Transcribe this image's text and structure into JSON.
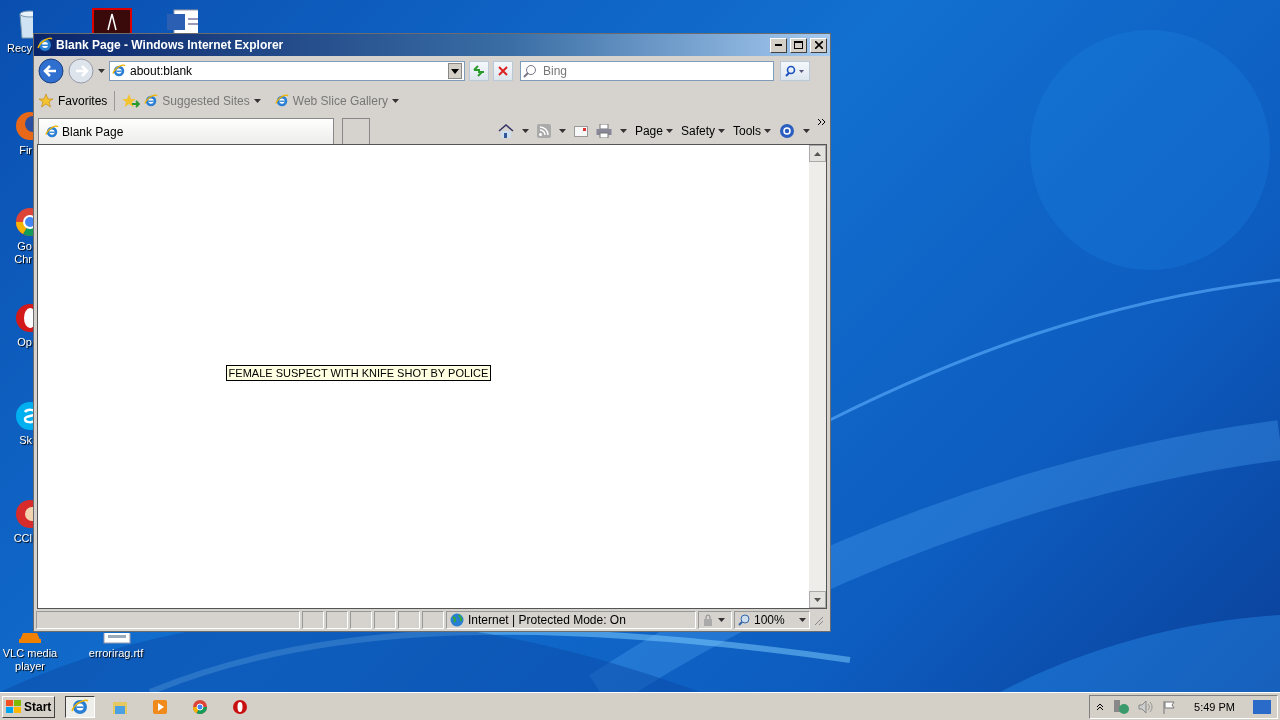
{
  "desktop": {
    "icons": [
      {
        "kind": "bin",
        "lines": [
          "Recy"
        ]
      },
      {
        "kind": "pdf"
      },
      {
        "kind": "word"
      },
      {
        "kind": "fox",
        "lines": [
          "Fir"
        ]
      },
      {
        "kind": "chrome",
        "lines": [
          "Go",
          "Chr"
        ]
      },
      {
        "kind": "opera",
        "lines": [
          "Op"
        ]
      },
      {
        "kind": "skype",
        "lines": [
          "Sk"
        ]
      },
      {
        "kind": "ccleaner",
        "lines": [
          "CCl"
        ]
      },
      {
        "kind": "vlc",
        "lines": [
          "VLC media",
          "player"
        ]
      },
      {
        "kind": "rtf",
        "lines": [
          "errorirag.rtf"
        ]
      }
    ]
  },
  "window": {
    "title": "Blank Page - Windows Internet Explorer",
    "address": "about:blank",
    "search": {
      "placeholder": "Bing"
    },
    "favorites": {
      "label": "Favorites",
      "items": [
        "Suggested Sites",
        "Web Slice Gallery"
      ]
    },
    "tabs": [
      {
        "label": "Blank Page",
        "selected": true
      }
    ],
    "commands": [
      "Page",
      "Safety",
      "Tools"
    ],
    "content": {
      "text": "FEMALE SUSPECT WITH KNIFE SHOT BY POLICE"
    },
    "status_bar": {
      "zone": "Internet | Protected Mode: On",
      "zoom": "100%"
    }
  },
  "taskbar": {
    "start": "Start",
    "pinned": [
      {
        "kind": "ie",
        "selected": true
      },
      {
        "kind": "folder",
        "selected": false
      },
      {
        "kind": "media",
        "selected": false
      },
      {
        "kind": "chrome",
        "selected": false
      },
      {
        "kind": "opera",
        "selected": false
      }
    ],
    "clock": "5:49 PM"
  }
}
